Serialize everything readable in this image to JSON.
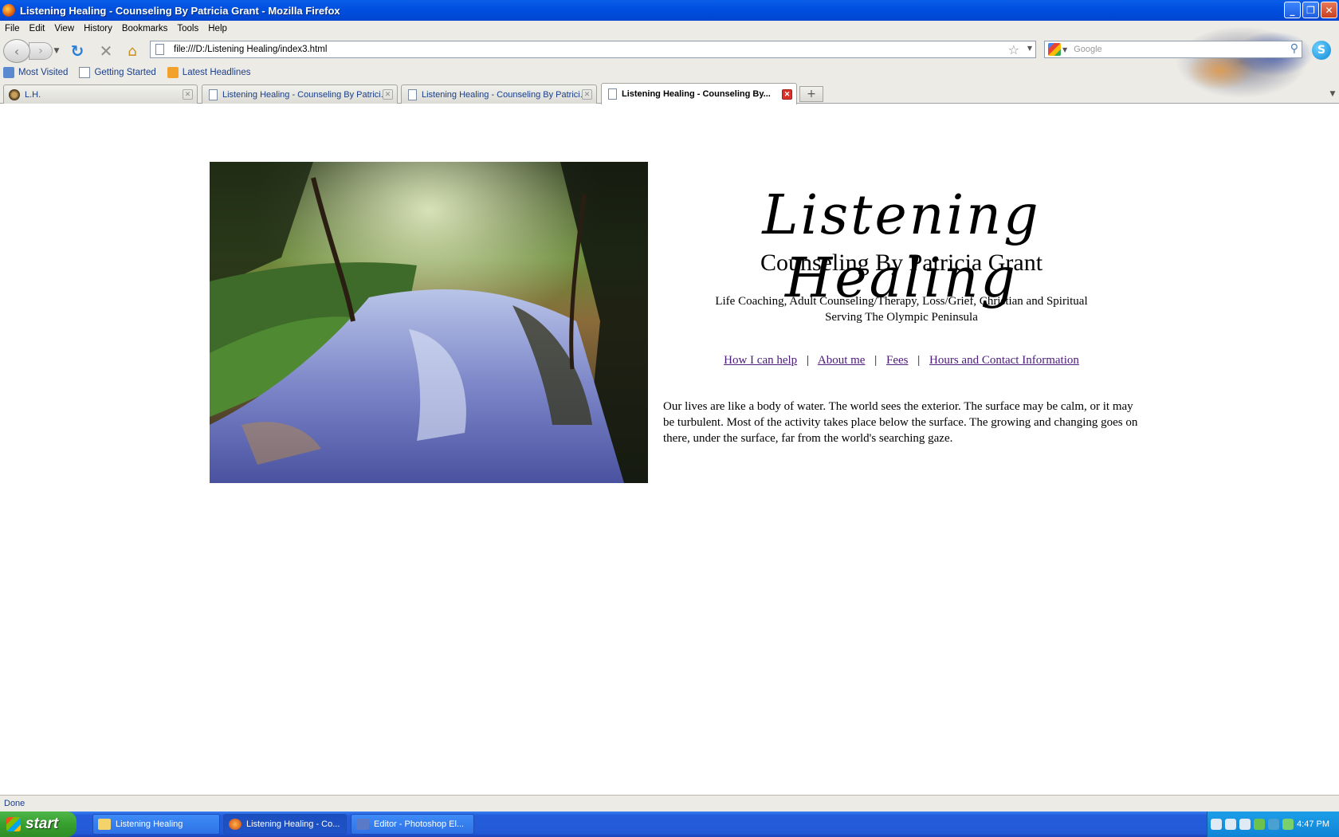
{
  "window": {
    "title": "Listening Healing - Counseling By Patricia Grant - Mozilla Firefox",
    "controls": {
      "minimize": "_",
      "maximize": "❐",
      "close": "✕"
    }
  },
  "menu": [
    "File",
    "Edit",
    "View",
    "History",
    "Bookmarks",
    "Tools",
    "Help"
  ],
  "nav": {
    "url": "file:///D:/Listening Healing/index3.html",
    "search_placeholder": "Google"
  },
  "bookmarks": [
    "Most Visited",
    "Getting Started",
    "Latest Headlines"
  ],
  "tabs": [
    {
      "label": "L.H.",
      "active": false
    },
    {
      "label": "Listening Healing - Counseling By Patrici...",
      "active": false
    },
    {
      "label": "Listening Healing - Counseling By Patrici...",
      "active": false
    },
    {
      "label": "Listening Healing - Counseling By...",
      "active": true
    }
  ],
  "page": {
    "site_title": "Listening Healing",
    "subtitle": "Counseling By Patricia Grant",
    "tagline_1": "Life Coaching, Adult Counseling/Therapy, Loss/Grief, Christian and Spiritual",
    "tagline_2": "Serving The Olympic Peninsula",
    "links": [
      "How I can help",
      "About me",
      "Fees",
      "Hours and Contact Information"
    ],
    "link_separator": "|",
    "intro": "Our lives are like a body of water. The world sees the exterior. The surface may be calm, or it may be turbulent. Most of the activity takes place below the surface. The growing and changing goes on there, under the surface, far from the world's searching gaze."
  },
  "status": "Done",
  "taskbar": {
    "start": "start",
    "tasks": [
      "Listening Healing",
      "Listening Healing - Co...",
      "Editor - Photoshop El..."
    ],
    "clock": "4:47 PM"
  },
  "colors": {
    "link": "#4b1a7a",
    "titlebar": "#0050e0",
    "taskbar": "#245edb"
  }
}
